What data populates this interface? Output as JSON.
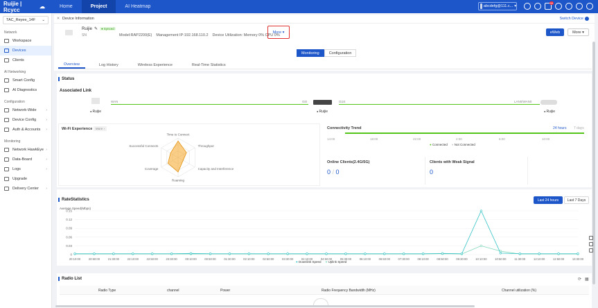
{
  "topbar": {
    "logo": "Ruijie | Rcycc",
    "nav": [
      "Home",
      "Project",
      "AI Heatmap"
    ],
    "account": "abcdefg@111.c..."
  },
  "sidebar": {
    "project": "TAC_Reyee_14F",
    "sections": [
      {
        "title": "Network",
        "items": [
          {
            "label": "Workspace"
          },
          {
            "label": "Devices",
            "active": true
          },
          {
            "label": "Clients"
          }
        ]
      },
      {
        "title": "AI Networking",
        "items": [
          {
            "label": "Smart Config"
          },
          {
            "label": "AI Diagnostics"
          }
        ]
      },
      {
        "title": "Configuration",
        "items": [
          {
            "label": "Network-Wide",
            "caret": true
          },
          {
            "label": "Device Config",
            "caret": true
          },
          {
            "label": "Auth & Accounts",
            "caret": true
          }
        ]
      },
      {
        "title": "Monitoring",
        "items": [
          {
            "label": "Network HawkEye",
            "caret": true
          },
          {
            "label": "Data-Board",
            "caret": true
          },
          {
            "label": "Logs",
            "caret": true
          },
          {
            "label": "Upgrade"
          },
          {
            "label": "Delivery Center",
            "caret": true
          }
        ]
      }
    ]
  },
  "breadcrumb": {
    "title": "Device Information",
    "switch": "Switch Device"
  },
  "device": {
    "name": "Ruijie",
    "status": "Synced",
    "sn": "SN",
    "model": "Model:RAP2200(E)",
    "mgmt_ip": "Management IP:192.168.110.2",
    "utilization": "Device Utilization: Memory 0% CPU 0%",
    "more": "More",
    "eweb": "eWeb",
    "more_btn": "More"
  },
  "segments": [
    "Monitoring",
    "Configuration"
  ],
  "tabs": [
    "Overview",
    "Log History",
    "Wireless Experience",
    "Real-Time Statistics"
  ],
  "status": {
    "title": "Status",
    "assoc_title": "Associated Link",
    "wan": "WAN",
    "g0": "Gi0",
    "g24": "Gi24",
    "lan": "LAN0/WAN0",
    "devices": [
      "Ruijie",
      "Ruijie",
      "Ruijie"
    ]
  },
  "wifi": {
    "title": "Wi-Fi Experience",
    "more": "More",
    "axes": [
      "Time to Connect",
      "Throughput",
      "Capacity and Interference",
      "Roaming",
      "Coverage",
      "Successful Connects"
    ],
    "values": [
      0.85,
      0.5,
      0.3,
      0.75,
      0.6,
      0.45
    ]
  },
  "trend": {
    "title": "Connectivity Trend",
    "range_a": "24 hours",
    "range_b": "7 days",
    "ticks": [
      "14:00",
      "18:00",
      "22:00",
      "2:00",
      "6:00",
      "10:00"
    ],
    "legend": [
      "Connected",
      "Not Connected"
    ]
  },
  "clients": {
    "online_title": "Online Clients(2.4G/5G)",
    "online_a": "0",
    "online_b": "0",
    "weak_title": "Clients with Weak Signal",
    "weak": "0"
  },
  "rate": {
    "title": "RateStatistics",
    "btn_24h": "Last 24 hours",
    "btn_7d": "Last 7 Days",
    "legend": [
      "Downlink Speed",
      "Uplink Speed"
    ],
    "colors": {
      "down": "#2fc1c4",
      "up": "#7fd7b9"
    }
  },
  "chart_data": {
    "type": "line",
    "ylabel": "Average Speed(Mbps)",
    "ylim": [
      0,
      0.15
    ],
    "yticks": [
      "0.15",
      "0.12",
      "0.09",
      "0.06",
      "0.03",
      "0"
    ],
    "x": [
      "20:10:00",
      "20:50:00",
      "21:30:00",
      "22:10:00",
      "22:50:00",
      "23:30:00",
      "00:10:00",
      "00:50:00",
      "01:30:00",
      "02:10:00",
      "02:50:00",
      "03:30:00",
      "04:10:00",
      "04:50:00",
      "05:30:00",
      "06:10:00",
      "06:50:00",
      "07:30:00",
      "08:10:00",
      "08:50:00",
      "09:30:00",
      "10:10:00",
      "10:50:00",
      "11:30:00",
      "12:10:00",
      "12:50:00",
      "13:30:00"
    ],
    "series": [
      {
        "name": "Downlink Speed",
        "values": [
          0.003,
          0.003,
          0.003,
          0.003,
          0.003,
          0.003,
          0.004,
          0.003,
          0.003,
          0.003,
          0.003,
          0.003,
          0.003,
          0.003,
          0.003,
          0.003,
          0.003,
          0.003,
          0.003,
          0.004,
          0.003,
          0.15,
          0.005,
          0.003,
          0.003,
          0.003,
          0.003
        ]
      },
      {
        "name": "Uplink Speed",
        "values": [
          0.002,
          0.002,
          0.002,
          0.002,
          0.002,
          0.002,
          0.002,
          0.002,
          0.002,
          0.002,
          0.002,
          0.002,
          0.002,
          0.002,
          0.002,
          0.002,
          0.002,
          0.002,
          0.002,
          0.003,
          0.002,
          0.03,
          0.012,
          0.002,
          0.002,
          0.002,
          0.002
        ]
      }
    ]
  },
  "radio": {
    "title": "Radio List",
    "columns": [
      "Radio Type",
      "channel",
      "Power",
      "Radio Frequency Bandwidth (MHz)",
      "Channel utilization (%)"
    ]
  }
}
